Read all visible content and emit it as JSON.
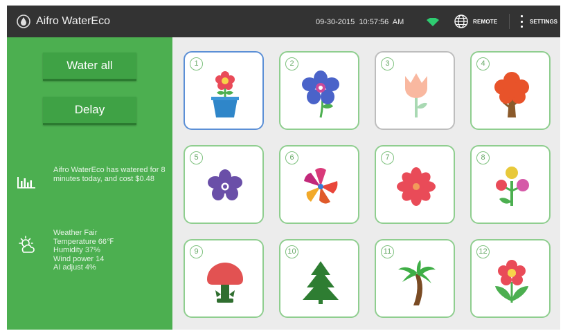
{
  "header": {
    "app_title": "Aifro WaterEco",
    "date": "09-30-2015",
    "time": "10:57:56",
    "ampm": "AM",
    "remote_label": "REMOTE",
    "settings_label": "SETTINGS",
    "wifi_color": "#2ecc71"
  },
  "sidebar": {
    "water_all_label": "Water all",
    "delay_label": "Delay",
    "usage_text": "Aifro WaterEco has watered for 8 minutes today, and cost $0.48",
    "weather": [
      "Weather Fair",
      "Temperature 66℉",
      "Humidity 37%",
      "Wind power 14",
      "AI adjust  4%"
    ],
    "bg_color": "#4caf50"
  },
  "zones": [
    {
      "number": "1",
      "plant": "potted-flower-icon"
    },
    {
      "number": "2",
      "plant": "blue-flower-icon"
    },
    {
      "number": "3",
      "plant": "tulip-icon"
    },
    {
      "number": "4",
      "plant": "red-tree-icon"
    },
    {
      "number": "5",
      "plant": "purple-flower-icon"
    },
    {
      "number": "6",
      "plant": "star-flower-icon"
    },
    {
      "number": "7",
      "plant": "red-flower-icon"
    },
    {
      "number": "8",
      "plant": "berry-plant-icon"
    },
    {
      "number": "9",
      "plant": "mushroom-bush-icon"
    },
    {
      "number": "10",
      "plant": "pine-tree-icon"
    },
    {
      "number": "11",
      "plant": "palm-tree-icon"
    },
    {
      "number": "12",
      "plant": "leafy-flower-icon"
    }
  ]
}
